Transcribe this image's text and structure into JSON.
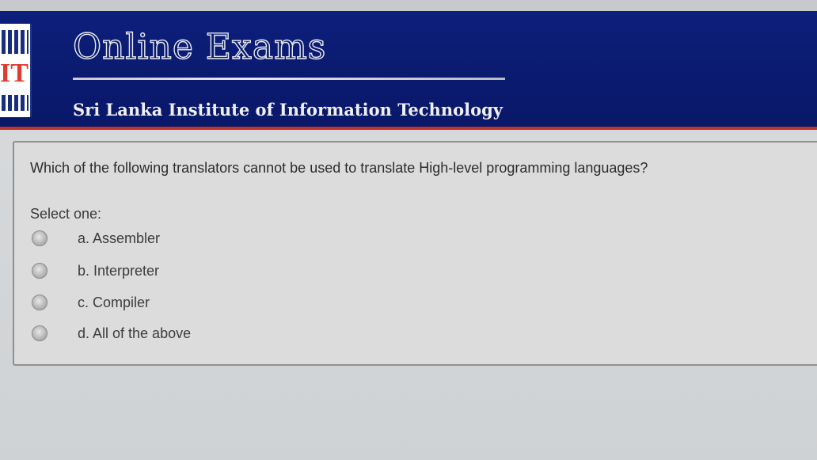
{
  "header": {
    "title": "Online Exams",
    "subtitle": "Sri Lanka Institute of Information Technology",
    "logo_text": "IT",
    "colors": {
      "banner": "#0a1a6e",
      "accent": "#c0322b"
    }
  },
  "question": {
    "text": "Which of the following translators cannot be used to translate High-level programming languages?",
    "select_label": "Select one:",
    "options": [
      {
        "label": "a. Assembler"
      },
      {
        "label": "b. Interpreter"
      },
      {
        "label": "c. Compiler"
      },
      {
        "label": "d. All of the above"
      }
    ]
  }
}
